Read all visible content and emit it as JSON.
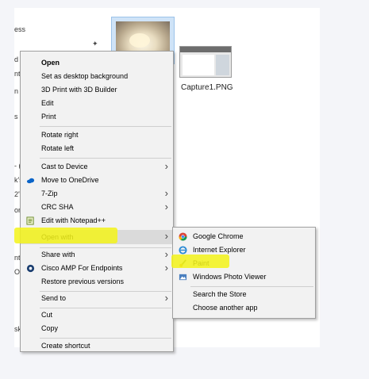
{
  "explorer": {
    "edge_text": [
      "ess",
      "d",
      "nt",
      "n",
      "s",
      "- (",
      "k's",
      "2'\\",
      "ore",
      "nt",
      "O",
      "sk"
    ],
    "capture_label": "Capture1.PNG"
  },
  "context_menu": {
    "items": [
      {
        "label": "Open"
      },
      {
        "label": "Set as desktop background"
      },
      {
        "label": "3D Print with 3D Builder"
      },
      {
        "label": "Edit"
      },
      {
        "label": "Print"
      },
      {
        "label": "Rotate right"
      },
      {
        "label": "Rotate left"
      },
      {
        "label": "Cast to Device"
      },
      {
        "label": "Move to OneDrive"
      },
      {
        "label": "7-Zip"
      },
      {
        "label": "CRC SHA"
      },
      {
        "label": "Edit with Notepad++"
      },
      {
        "label": "Open with"
      },
      {
        "label": "Share with"
      },
      {
        "label": "Cisco AMP For Endpoints"
      },
      {
        "label": "Restore previous versions"
      },
      {
        "label": "Send to"
      },
      {
        "label": "Cut"
      },
      {
        "label": "Copy"
      },
      {
        "label": "Create shortcut"
      }
    ]
  },
  "open_with_submenu": {
    "items": [
      {
        "label": "Google Chrome"
      },
      {
        "label": "Internet Explorer"
      },
      {
        "label": "Paint"
      },
      {
        "label": "Windows Photo Viewer"
      },
      {
        "label": "Search the Store"
      },
      {
        "label": "Choose another app"
      }
    ]
  },
  "colors": {
    "highlight": "#f3f319",
    "menu_bg": "#f2f2f2",
    "hover_row": "#dadada",
    "page_bg": "#f4f5f9"
  }
}
